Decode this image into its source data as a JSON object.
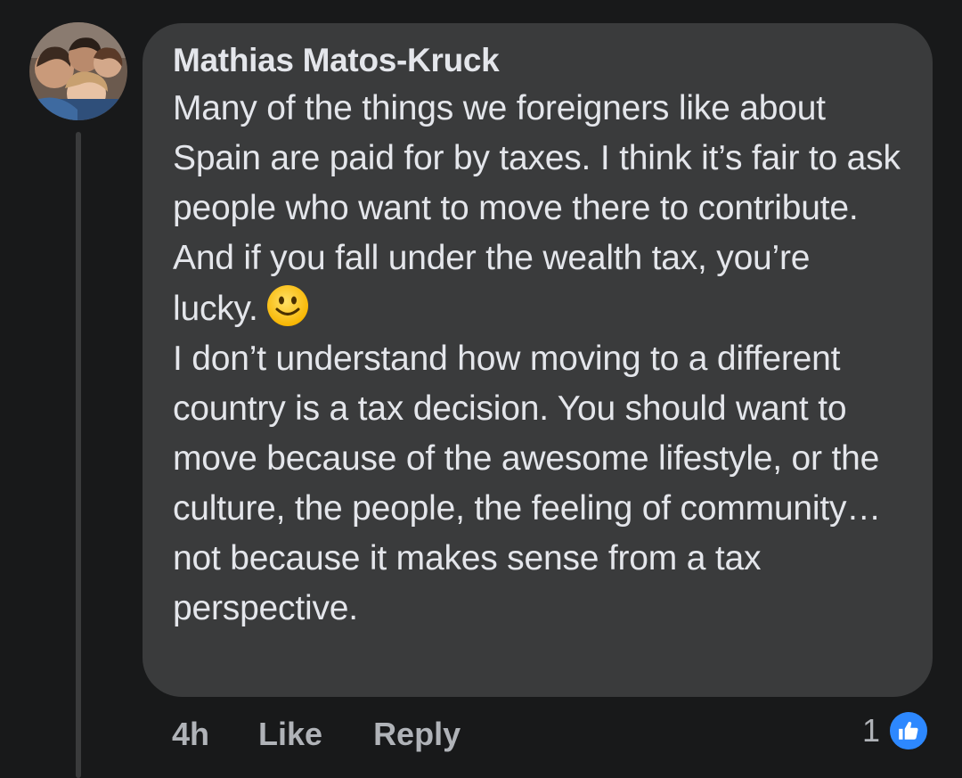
{
  "comment": {
    "author": "Mathias Matos-Kruck",
    "paragraphs": [
      "Many of the things we foreigners like about Spain are paid for by taxes. I think it’s fair to ask people who want to move there to contribute. And if you fall under the wealth tax, you’re lucky.",
      "I don’t understand how moving to a different country is a tax decision. You should want to move because of the awesome lifestyle, or the culture, the people, the feeling of community… not because it makes sense from a tax perspective."
    ],
    "emoji": "slightly-smiling-face-icon"
  },
  "actions": {
    "time": "4h",
    "like_label": "Like",
    "reply_label": "Reply"
  },
  "reactions": {
    "count": "1",
    "icon": "thumbs-up-icon"
  },
  "colors": {
    "background": "#18191a",
    "bubble": "#3a3b3c",
    "text": "#e4e6eb",
    "secondary_text": "#b0b3b8",
    "like_blue": "#2d88ff"
  }
}
